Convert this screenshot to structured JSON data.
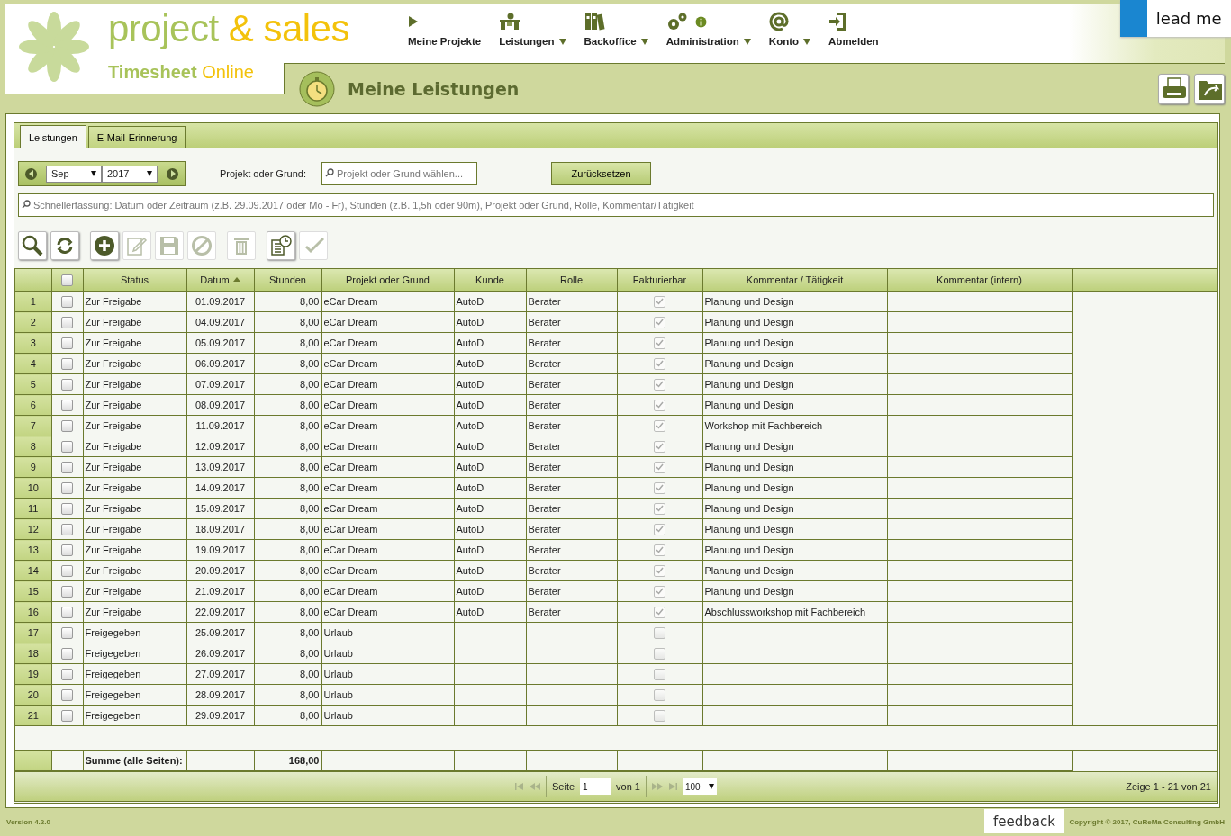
{
  "logo": {
    "word_1": "project",
    "ampersand": "&",
    "word_2": "sales",
    "sub_1": "Timesheet",
    "sub_2": "Online"
  },
  "nav": [
    {
      "label": "Meine Projekte",
      "has_menu": false,
      "info_badge": false
    },
    {
      "label": "Leistungen",
      "has_menu": true,
      "info_badge": false
    },
    {
      "label": "Backoffice",
      "has_menu": true,
      "info_badge": false
    },
    {
      "label": "Administration",
      "has_menu": true,
      "info_badge": true
    },
    {
      "label": "Konto",
      "has_menu": true,
      "info_badge": false
    },
    {
      "label": "Abmelden",
      "has_menu": false,
      "info_badge": false
    }
  ],
  "lead_me": "lead me",
  "page_title": "Meine Leistungen",
  "tabs": [
    {
      "label": "Leistungen",
      "selected": true
    },
    {
      "label": "E-Mail-Erinnerung",
      "selected": false
    }
  ],
  "filter": {
    "month": "Sep",
    "year": "2017",
    "project_label": "Projekt oder Grund:",
    "project_placeholder": "Projekt oder Grund wählen...",
    "reset": "Zurücksetzen"
  },
  "quick_entry": {
    "placeholder": "Schnellerfassung: Datum oder Zeitraum (z.B. 29.09.2017 oder Mo - Fr), Stunden (z.B. 1,5h oder 90m), Projekt oder Grund, Rolle, Kommentar/Tätigkeit"
  },
  "toolbar": [
    {
      "disabled": false
    },
    {
      "disabled": false
    },
    {
      "disabled": false
    },
    {
      "disabled": true
    },
    {
      "disabled": true
    },
    {
      "disabled": true
    },
    {
      "disabled": true
    },
    {
      "disabled": false
    },
    {
      "disabled": true
    }
  ],
  "table": {
    "select_all_checked": false,
    "columns": [
      {
        "label": "Status",
        "sorted": false
      },
      {
        "label": "Datum",
        "sorted": true
      },
      {
        "label": "Stunden",
        "sorted": false
      },
      {
        "label": "Projekt oder Grund",
        "sorted": false
      },
      {
        "label": "Kunde",
        "sorted": false
      },
      {
        "label": "Rolle",
        "sorted": false
      },
      {
        "label": "Fakturierbar",
        "sorted": false
      },
      {
        "label": "Kommentar / Tätigkeit",
        "sorted": false
      },
      {
        "label": "Kommentar (intern)",
        "sorted": false
      }
    ],
    "rows": [
      {
        "no": "1",
        "checked": false,
        "status": "Zur Freigabe",
        "date": "01.09.2017",
        "hours": "8,00",
        "project": "eCar Dream",
        "customer": "AutoD",
        "role": "Berater",
        "billable": true,
        "billable_disabled": true,
        "comment": "Planung und Design"
      },
      {
        "no": "2",
        "checked": false,
        "status": "Zur Freigabe",
        "date": "04.09.2017",
        "hours": "8,00",
        "project": "eCar Dream",
        "customer": "AutoD",
        "role": "Berater",
        "billable": true,
        "billable_disabled": true,
        "comment": "Planung und Design"
      },
      {
        "no": "3",
        "checked": false,
        "status": "Zur Freigabe",
        "date": "05.09.2017",
        "hours": "8,00",
        "project": "eCar Dream",
        "customer": "AutoD",
        "role": "Berater",
        "billable": true,
        "billable_disabled": true,
        "comment": "Planung und Design"
      },
      {
        "no": "4",
        "checked": false,
        "status": "Zur Freigabe",
        "date": "06.09.2017",
        "hours": "8,00",
        "project": "eCar Dream",
        "customer": "AutoD",
        "role": "Berater",
        "billable": true,
        "billable_disabled": true,
        "comment": "Planung und Design"
      },
      {
        "no": "5",
        "checked": false,
        "status": "Zur Freigabe",
        "date": "07.09.2017",
        "hours": "8,00",
        "project": "eCar Dream",
        "customer": "AutoD",
        "role": "Berater",
        "billable": true,
        "billable_disabled": true,
        "comment": "Planung und Design"
      },
      {
        "no": "6",
        "checked": false,
        "status": "Zur Freigabe",
        "date": "08.09.2017",
        "hours": "8,00",
        "project": "eCar Dream",
        "customer": "AutoD",
        "role": "Berater",
        "billable": true,
        "billable_disabled": true,
        "comment": "Planung und Design"
      },
      {
        "no": "7",
        "checked": false,
        "status": "Zur Freigabe",
        "date": "11.09.2017",
        "hours": "8,00",
        "project": "eCar Dream",
        "customer": "AutoD",
        "role": "Berater",
        "billable": true,
        "billable_disabled": true,
        "comment": "Workshop mit Fachbereich"
      },
      {
        "no": "8",
        "checked": false,
        "status": "Zur Freigabe",
        "date": "12.09.2017",
        "hours": "8,00",
        "project": "eCar Dream",
        "customer": "AutoD",
        "role": "Berater",
        "billable": true,
        "billable_disabled": true,
        "comment": "Planung und Design"
      },
      {
        "no": "9",
        "checked": false,
        "status": "Zur Freigabe",
        "date": "13.09.2017",
        "hours": "8,00",
        "project": "eCar Dream",
        "customer": "AutoD",
        "role": "Berater",
        "billable": true,
        "billable_disabled": true,
        "comment": "Planung und Design"
      },
      {
        "no": "10",
        "checked": false,
        "status": "Zur Freigabe",
        "date": "14.09.2017",
        "hours": "8,00",
        "project": "eCar Dream",
        "customer": "AutoD",
        "role": "Berater",
        "billable": true,
        "billable_disabled": true,
        "comment": "Planung und Design"
      },
      {
        "no": "11",
        "checked": false,
        "status": "Zur Freigabe",
        "date": "15.09.2017",
        "hours": "8,00",
        "project": "eCar Dream",
        "customer": "AutoD",
        "role": "Berater",
        "billable": true,
        "billable_disabled": true,
        "comment": "Planung und Design"
      },
      {
        "no": "12",
        "checked": false,
        "status": "Zur Freigabe",
        "date": "18.09.2017",
        "hours": "8,00",
        "project": "eCar Dream",
        "customer": "AutoD",
        "role": "Berater",
        "billable": true,
        "billable_disabled": true,
        "comment": "Planung und Design"
      },
      {
        "no": "13",
        "checked": false,
        "status": "Zur Freigabe",
        "date": "19.09.2017",
        "hours": "8,00",
        "project": "eCar Dream",
        "customer": "AutoD",
        "role": "Berater",
        "billable": true,
        "billable_disabled": true,
        "comment": "Planung und Design"
      },
      {
        "no": "14",
        "checked": false,
        "status": "Zur Freigabe",
        "date": "20.09.2017",
        "hours": "8,00",
        "project": "eCar Dream",
        "customer": "AutoD",
        "role": "Berater",
        "billable": true,
        "billable_disabled": true,
        "comment": "Planung und Design"
      },
      {
        "no": "15",
        "checked": false,
        "status": "Zur Freigabe",
        "date": "21.09.2017",
        "hours": "8,00",
        "project": "eCar Dream",
        "customer": "AutoD",
        "role": "Berater",
        "billable": true,
        "billable_disabled": true,
        "comment": "Planung und Design"
      },
      {
        "no": "16",
        "checked": false,
        "status": "Zur Freigabe",
        "date": "22.09.2017",
        "hours": "8,00",
        "project": "eCar Dream",
        "customer": "AutoD",
        "role": "Berater",
        "billable": true,
        "billable_disabled": true,
        "comment": "Abschlussworkshop mit Fachbereich"
      },
      {
        "no": "17",
        "checked": false,
        "status": "Freigegeben",
        "date": "25.09.2017",
        "hours": "8,00",
        "project": "Urlaub",
        "billable": false,
        "billable_disabled": true
      },
      {
        "no": "18",
        "checked": false,
        "status": "Freigegeben",
        "date": "26.09.2017",
        "hours": "8,00",
        "project": "Urlaub",
        "billable": false,
        "billable_disabled": true
      },
      {
        "no": "19",
        "checked": false,
        "status": "Freigegeben",
        "date": "27.09.2017",
        "hours": "8,00",
        "project": "Urlaub",
        "billable": false,
        "billable_disabled": true
      },
      {
        "no": "20",
        "checked": false,
        "status": "Freigegeben",
        "date": "28.09.2017",
        "hours": "8,00",
        "project": "Urlaub",
        "billable": false,
        "billable_disabled": true
      },
      {
        "no": "21",
        "checked": false,
        "status": "Freigegeben",
        "date": "29.09.2017",
        "hours": "8,00",
        "project": "Urlaub",
        "billable": false,
        "billable_disabled": true
      }
    ],
    "sum_label": "Summe (alle Seiten):",
    "sum_value": "168,00"
  },
  "pager": {
    "page_label": "Seite",
    "page": "1",
    "of": "von 1",
    "page_size": "100",
    "summary": "Zeige 1 - 21 von 21"
  },
  "footer": {
    "version": "Version 4.2.0",
    "feedback": "feedback",
    "copyright": "Copyright © 2017, CuReMa Consulting GmbH"
  }
}
